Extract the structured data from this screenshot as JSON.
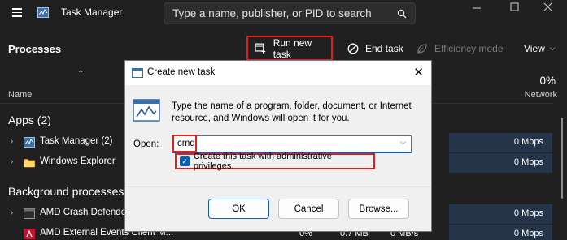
{
  "window": {
    "title": "Task Manager",
    "search_placeholder": "Type a name, publisher, or PID to search"
  },
  "toolbar": {
    "page_title": "Processes",
    "run_new_task": "Run new task",
    "end_task": "End task",
    "efficiency_mode": "Efficiency mode",
    "view": "View"
  },
  "columns": {
    "name": "Name",
    "network_pct": "0%",
    "network": "Network"
  },
  "groups": {
    "apps": "Apps (2)",
    "background": "Background processes"
  },
  "rows": [
    {
      "name": "Task Manager (2)",
      "cpu": "",
      "memory": "",
      "disk": "",
      "network": "0 Mbps",
      "icon": "task-manager-icon"
    },
    {
      "name": "Windows Explorer",
      "cpu": "",
      "memory": "",
      "disk": "",
      "network": "0 Mbps",
      "icon": "folder-icon"
    },
    {
      "name": "AMD Crash Defender",
      "cpu": "",
      "memory": "",
      "disk": "",
      "network": "0 Mbps",
      "icon": "app-icon"
    },
    {
      "name": "AMD External Events Client M...",
      "cpu": "0%",
      "memory": "0.7 MB",
      "disk": "0 MB/s",
      "network": "0 Mbps",
      "icon": "amd-icon"
    }
  ],
  "dialog": {
    "title": "Create new task",
    "description": "Type the name of a program, folder, document, or Internet resource, and Windows will open it for you.",
    "open_label": "Open:",
    "open_value": "cmd",
    "admin_checkbox": "Create this task with administrative privileges.",
    "admin_checked": true,
    "ok": "OK",
    "cancel": "Cancel",
    "browse": "Browse..."
  },
  "colors": {
    "highlight": "#e0201e",
    "accent": "#0a5fb4",
    "network_column": "#26344a"
  }
}
